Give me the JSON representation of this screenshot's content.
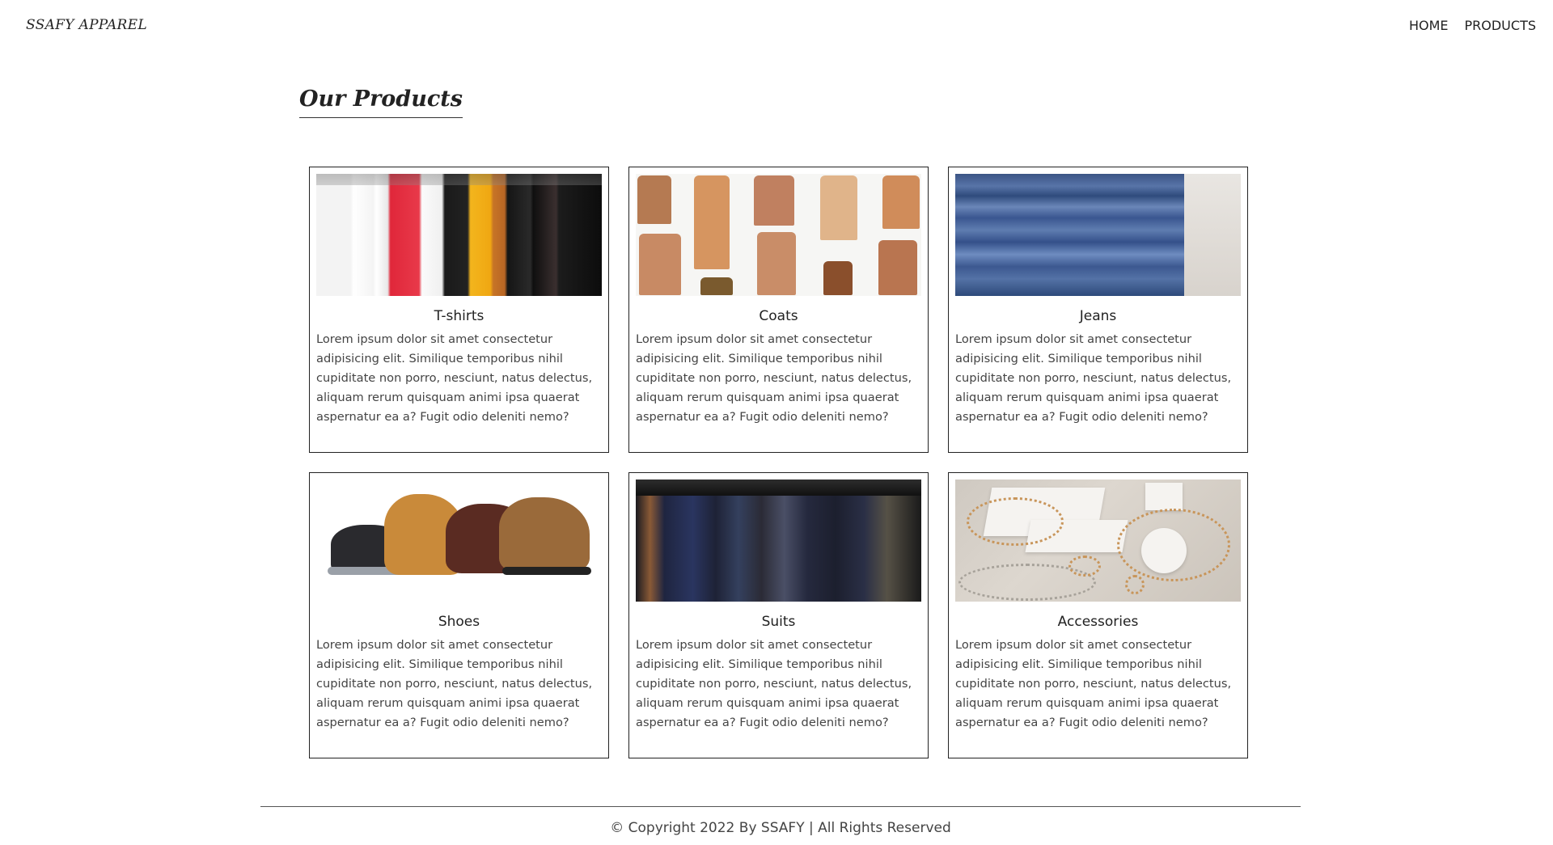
{
  "nav": {
    "brand": "SSAFY APPAREL",
    "links": [
      "HOME",
      "PRODUCTS"
    ]
  },
  "section": {
    "title": "Our Products"
  },
  "products": [
    {
      "name": "T-shirts",
      "image_icon": "tshirts-photo",
      "description": "Lorem ipsum dolor sit amet consectetur adipisicing elit. Similique temporibus nihil cupiditate non porro, nesciunt, natus delectus, aliquam rerum quisquam animi ipsa quaerat aspernatur ea a? Fugit odio deleniti nemo?"
    },
    {
      "name": "Coats",
      "image_icon": "coats-photo",
      "description": "Lorem ipsum dolor sit amet consectetur adipisicing elit. Similique temporibus nihil cupiditate non porro, nesciunt, natus delectus, aliquam rerum quisquam animi ipsa quaerat aspernatur ea a? Fugit odio deleniti nemo?"
    },
    {
      "name": "Jeans",
      "image_icon": "jeans-photo",
      "description": "Lorem ipsum dolor sit amet consectetur adipisicing elit. Similique temporibus nihil cupiditate non porro, nesciunt, natus delectus, aliquam rerum quisquam animi ipsa quaerat aspernatur ea a? Fugit odio deleniti nemo?"
    },
    {
      "name": "Shoes",
      "image_icon": "shoes-photo",
      "description": "Lorem ipsum dolor sit amet consectetur adipisicing elit. Similique temporibus nihil cupiditate non porro, nesciunt, natus delectus, aliquam rerum quisquam animi ipsa quaerat aspernatur ea a? Fugit odio deleniti nemo?"
    },
    {
      "name": "Suits",
      "image_icon": "suits-photo",
      "description": "Lorem ipsum dolor sit amet consectetur adipisicing elit. Similique temporibus nihil cupiditate non porro, nesciunt, natus delectus, aliquam rerum quisquam animi ipsa quaerat aspernatur ea a? Fugit odio deleniti nemo?"
    },
    {
      "name": "Accessories",
      "image_icon": "accessories-photo",
      "description": "Lorem ipsum dolor sit amet consectetur adipisicing elit. Similique temporibus nihil cupiditate non porro, nesciunt, natus delectus, aliquam rerum quisquam animi ipsa quaerat aspernatur ea a? Fugit odio deleniti nemo?"
    }
  ],
  "footer": {
    "text": "© Copyright 2022 By SSAFY | All Rights Reserved"
  }
}
